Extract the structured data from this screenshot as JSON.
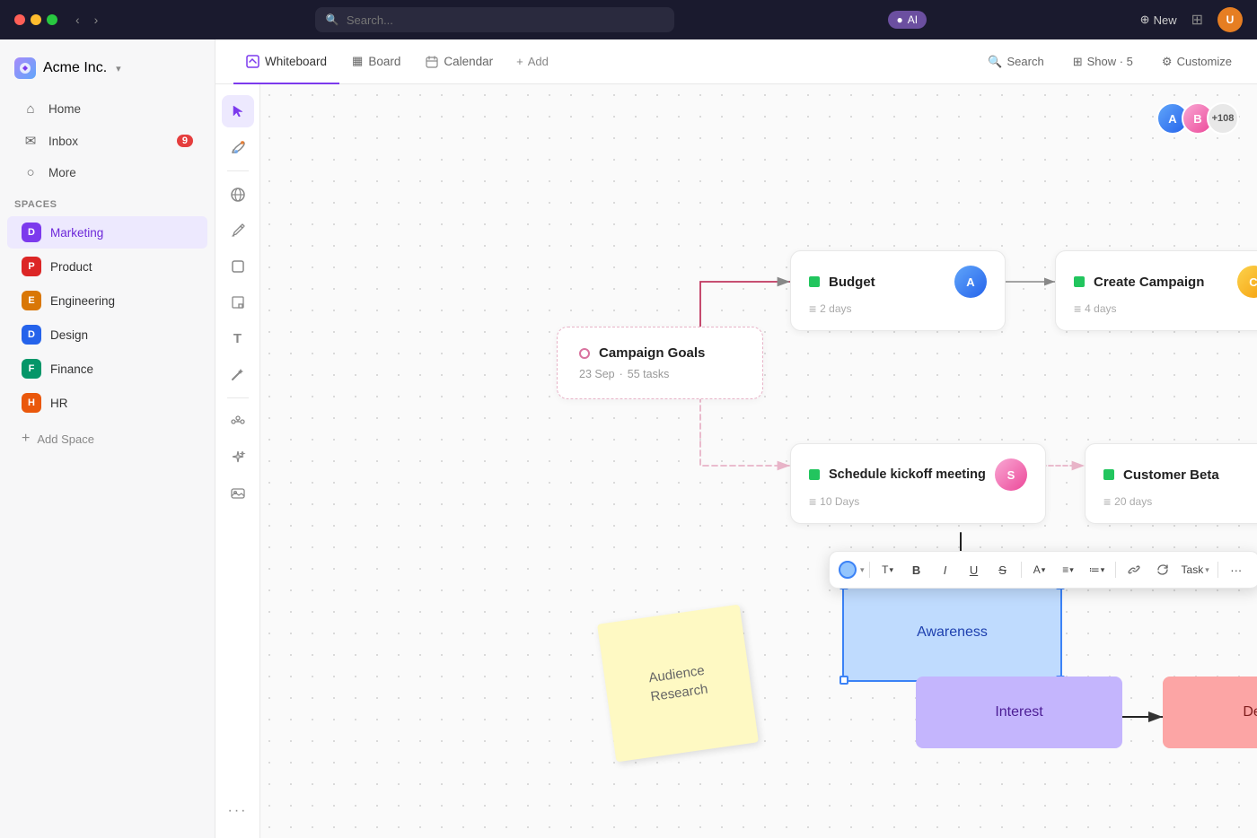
{
  "topbar": {
    "search_placeholder": "Search...",
    "ai_label": "AI",
    "new_label": "New"
  },
  "sidebar": {
    "brand": "Acme Inc.",
    "nav": [
      {
        "id": "home",
        "label": "Home",
        "icon": "⌂"
      },
      {
        "id": "inbox",
        "label": "Inbox",
        "icon": "✉",
        "badge": "9"
      },
      {
        "id": "more",
        "label": "More",
        "icon": "○"
      }
    ],
    "spaces_label": "Spaces",
    "spaces": [
      {
        "id": "marketing",
        "label": "Marketing",
        "letter": "D",
        "color": "icon-marketing",
        "active": true
      },
      {
        "id": "product",
        "label": "Product",
        "letter": "P",
        "color": "icon-product"
      },
      {
        "id": "engineering",
        "label": "Engineering",
        "letter": "E",
        "color": "icon-engineering"
      },
      {
        "id": "design",
        "label": "Design",
        "letter": "D",
        "color": "icon-design"
      },
      {
        "id": "finance",
        "label": "Finance",
        "letter": "F",
        "color": "icon-finance"
      },
      {
        "id": "hr",
        "label": "HR",
        "letter": "H",
        "color": "icon-hr"
      }
    ],
    "add_space": "Add Space"
  },
  "tabs": [
    {
      "id": "whiteboard",
      "label": "Whiteboard",
      "icon": "⊡",
      "active": true
    },
    {
      "id": "board",
      "label": "Board",
      "icon": "▦"
    },
    {
      "id": "calendar",
      "label": "Calendar",
      "icon": "📅"
    },
    {
      "id": "add",
      "label": "Add",
      "icon": "+"
    }
  ],
  "tabbar_actions": [
    {
      "id": "search",
      "label": "Search",
      "icon": "🔍"
    },
    {
      "id": "show",
      "label": "Show · 5",
      "icon": "⊞"
    },
    {
      "id": "customize",
      "label": "Customize",
      "icon": "⚙"
    }
  ],
  "tools": [
    {
      "id": "select",
      "icon": "↖",
      "active": true
    },
    {
      "id": "draw",
      "icon": "✦"
    },
    {
      "id": "globe",
      "icon": "🌐"
    },
    {
      "id": "pen",
      "icon": "✏"
    },
    {
      "id": "shape",
      "icon": "□"
    },
    {
      "id": "sticky",
      "icon": "◻"
    },
    {
      "id": "text",
      "icon": "T"
    },
    {
      "id": "magic",
      "icon": "✦"
    },
    {
      "id": "connect",
      "icon": "⊕"
    },
    {
      "id": "sparkle",
      "icon": "✧"
    },
    {
      "id": "image",
      "icon": "🖼"
    },
    {
      "id": "more",
      "icon": "···"
    }
  ],
  "cards": {
    "campaign_goals": {
      "title": "Campaign Goals",
      "date": "23 Sep",
      "separator": "·",
      "tasks": "55 tasks"
    },
    "budget": {
      "title": "Budget",
      "duration": "2 days"
    },
    "create_campaign": {
      "title": "Create Campaign",
      "duration": "4 days"
    },
    "schedule_kickoff": {
      "title": "Schedule kickoff meeting",
      "duration": "10 Days"
    },
    "customer_beta": {
      "title": "Customer Beta",
      "duration": "20 days"
    }
  },
  "shapes": {
    "awareness": "Awareness",
    "interest": "Interest",
    "decision": "Decision"
  },
  "sticky_note": {
    "text": "Audience\nResearch"
  },
  "avatars_count": "+108",
  "format_toolbar": {
    "task_label": "Task"
  }
}
